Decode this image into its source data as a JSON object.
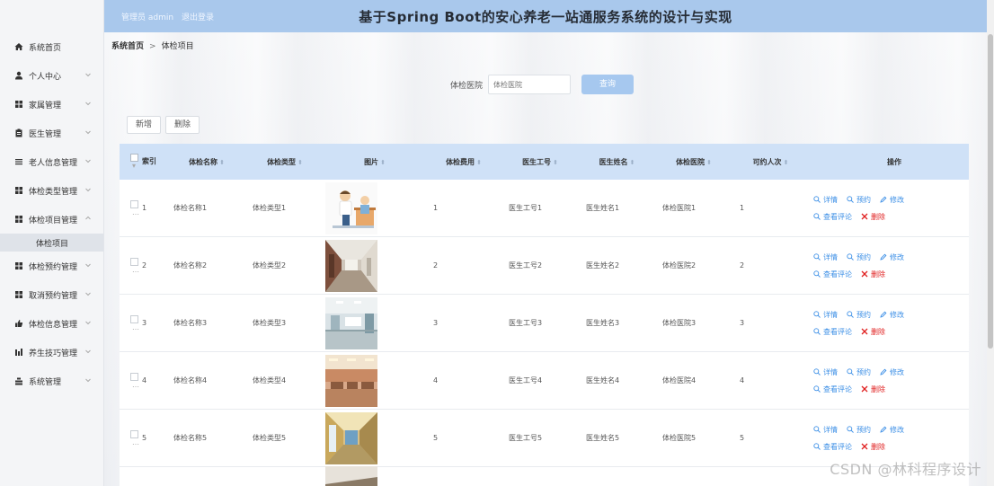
{
  "header": {
    "role": "管理员 admin",
    "logout": "退出登录",
    "title": "基于Spring Boot的安心养老一站通服务系统的设计与实现"
  },
  "sidebar": {
    "items": [
      {
        "label": "系统首页",
        "icon": "home-icon"
      },
      {
        "label": "个人中心",
        "icon": "user-icon"
      },
      {
        "label": "家属管理",
        "icon": "grid-icon"
      },
      {
        "label": "医生管理",
        "icon": "clipboard-icon"
      },
      {
        "label": "老人信息管理",
        "icon": "list-icon"
      },
      {
        "label": "体检类型管理",
        "icon": "grid-icon"
      },
      {
        "label": "体检项目管理",
        "icon": "grid-icon"
      },
      {
        "label": "体检预约管理",
        "icon": "grid-icon"
      },
      {
        "label": "取消预约管理",
        "icon": "grid-icon"
      },
      {
        "label": "体检信息管理",
        "icon": "thumb-icon"
      },
      {
        "label": "养生技巧管理",
        "icon": "bar-chart-icon"
      },
      {
        "label": "系统管理",
        "icon": "stack-icon"
      }
    ],
    "active_sub": "体检项目"
  },
  "breadcrumb": {
    "home": "系统首页",
    "separator": ">",
    "current": "体检项目"
  },
  "search": {
    "label": "体检医院",
    "placeholder": "体检医院",
    "button": "查询"
  },
  "toolbar": {
    "add": "新增",
    "delete": "删除"
  },
  "table": {
    "columns": {
      "index": "索引",
      "name": "体检名称",
      "type": "体检类型",
      "image": "图片",
      "fee": "体检费用",
      "doctor_id": "医生工号",
      "doctor_name": "医生姓名",
      "hospital": "体检医院",
      "capacity": "可约人次",
      "ops": "操作"
    },
    "actions": {
      "detail": "详情",
      "reserve": "预约",
      "edit": "修改",
      "review": "查看评论",
      "remove": "删除"
    },
    "rows": [
      {
        "idx": "1",
        "name": "体检名称1",
        "type": "体检类型1",
        "fee": "1",
        "doctor_id": "医生工号1",
        "doctor_name": "医生姓名1",
        "hospital": "体检医院1",
        "capacity": "1"
      },
      {
        "idx": "2",
        "name": "体检名称2",
        "type": "体检类型2",
        "fee": "2",
        "doctor_id": "医生工号2",
        "doctor_name": "医生姓名2",
        "hospital": "体检医院2",
        "capacity": "2"
      },
      {
        "idx": "3",
        "name": "体检名称3",
        "type": "体检类型3",
        "fee": "3",
        "doctor_id": "医生工号3",
        "doctor_name": "医生姓名3",
        "hospital": "体检医院3",
        "capacity": "3"
      },
      {
        "idx": "4",
        "name": "体检名称4",
        "type": "体检类型4",
        "fee": "4",
        "doctor_id": "医生工号4",
        "doctor_name": "医生姓名4",
        "hospital": "体检医院4",
        "capacity": "4"
      },
      {
        "idx": "5",
        "name": "体检名称5",
        "type": "体检类型5",
        "fee": "5",
        "doctor_id": "医生工号5",
        "doctor_name": "医生姓名5",
        "hospital": "体检医院5",
        "capacity": "5"
      }
    ]
  },
  "watermark": "CSDN @林科程序设计",
  "colors": {
    "header_bg": "#a9c8ec",
    "table_head_bg": "#cfe1f7",
    "action_blue": "#3a8ee6",
    "action_red": "#e02020",
    "search_button": "#a6c8ef"
  }
}
